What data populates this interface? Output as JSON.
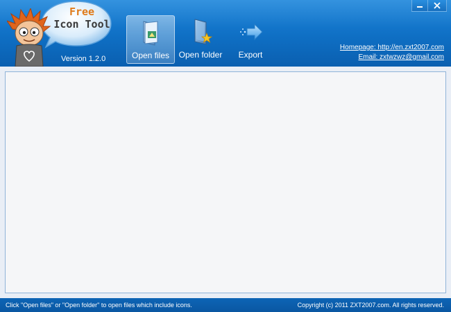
{
  "app": {
    "logo_line1": "Free",
    "logo_line2": "Icon Tool",
    "version": "Version 1.2.0"
  },
  "window_controls": {
    "minimize_icon": "minimize-icon",
    "close_icon": "close-icon"
  },
  "toolbar": {
    "buttons": [
      {
        "label": "Open files",
        "icon": "open-files-icon",
        "active": true
      },
      {
        "label": "Open folder",
        "icon": "open-folder-icon",
        "active": false
      },
      {
        "label": "Export",
        "icon": "export-arrow-icon",
        "active": false
      }
    ]
  },
  "links": {
    "homepage": "Homepage: http://en.zxt2007.com",
    "email": "Email: zxtwzwz@gmail.com"
  },
  "status": {
    "hint": "Click \"Open files\" or \"Open folder\" to open files which include icons.",
    "copyright": "Copyright (c) 2011 ZXT2007.com. All rights reserved."
  },
  "colors": {
    "header": "#1478cf",
    "status_bar": "#0b5ca9",
    "logo_orange": "#e07b1a",
    "panel_border": "#8fb3d8"
  }
}
